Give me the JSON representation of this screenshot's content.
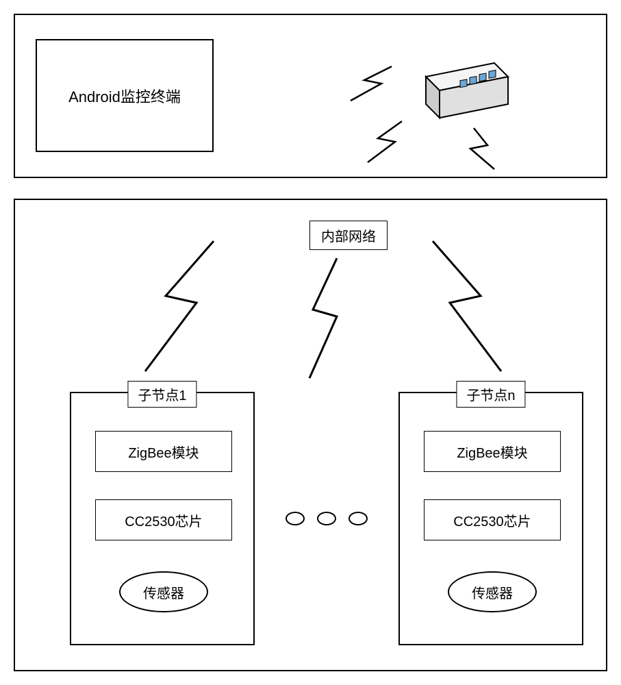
{
  "top": {
    "android_terminal": "Android监控终端"
  },
  "bottom": {
    "inner_network": "内部网络",
    "nodes": [
      {
        "title": "子节点1",
        "zigbee": "ZigBee模块",
        "chip": "CC2530芯片",
        "sensor": "传感器"
      },
      {
        "title": "子节点n",
        "zigbee": "ZigBee模块",
        "chip": "CC2530芯片",
        "sensor": "传感器"
      }
    ]
  }
}
